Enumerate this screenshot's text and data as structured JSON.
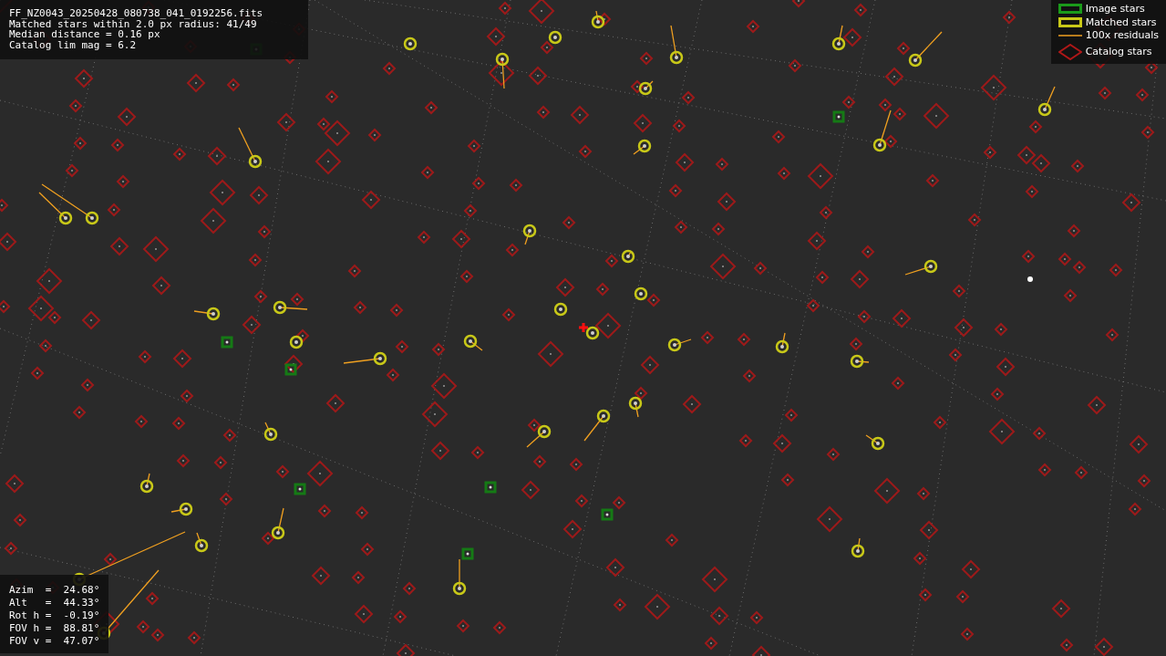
{
  "file_info": {
    "lines": [
      "FF_NZ0043_20250428_080738_041_0192256.fits",
      "Matched stars within 2.0 px radius: 41/49",
      "Median distance = 0.16 px",
      "Catalog lim mag = 6.2"
    ]
  },
  "legend": [
    {
      "kind": "image",
      "label": "Image stars"
    },
    {
      "kind": "matched",
      "label": "Matched stars"
    },
    {
      "kind": "residual",
      "label": "100x residuals"
    },
    {
      "kind": "catalog",
      "label": "Catalog stars"
    }
  ],
  "pointing": [
    {
      "label": "Azim  =",
      "value": "24.68°"
    },
    {
      "label": "Alt   =",
      "value": "44.33°"
    },
    {
      "label": "Rot h =",
      "value": "-0.19°"
    },
    {
      "label": "FOV h =",
      "value": "88.81°"
    },
    {
      "label": "FOV v =",
      "value": "47.07°"
    }
  ]
}
